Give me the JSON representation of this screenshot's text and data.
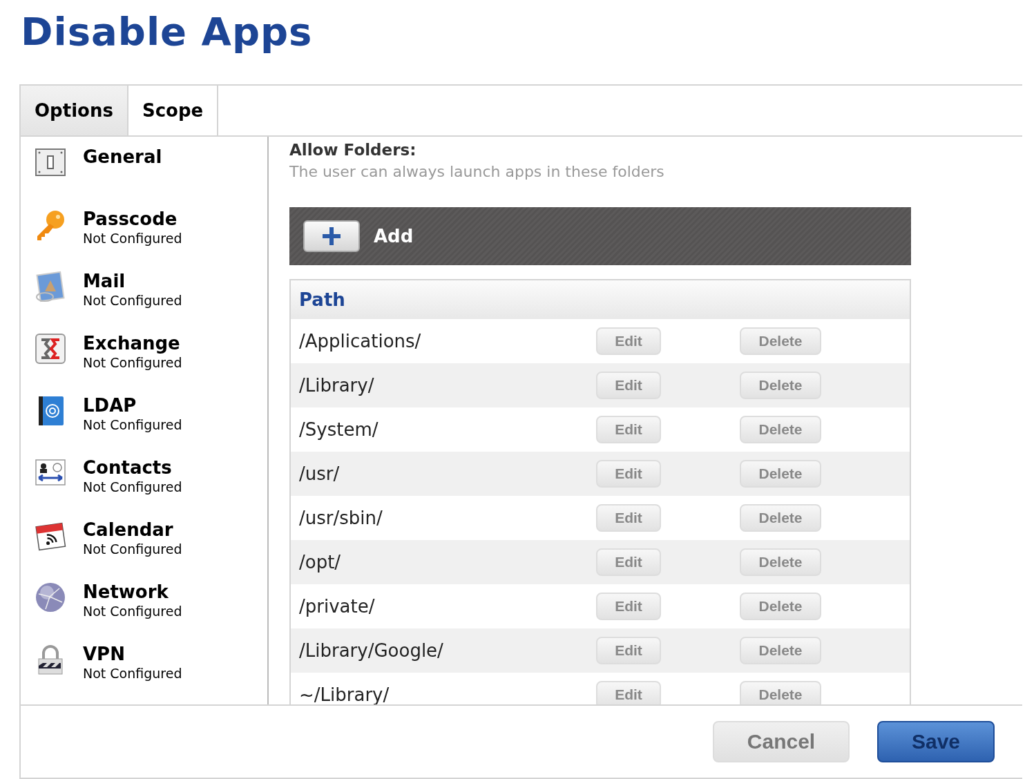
{
  "page": {
    "title": "Disable Apps"
  },
  "tabs": [
    {
      "label": "Options",
      "selected": true
    },
    {
      "label": "Scope",
      "selected": false
    }
  ],
  "sidebar": {
    "items": [
      {
        "name": "General"
      },
      {
        "name": "Passcode",
        "status": "Not Configured"
      },
      {
        "name": "Mail",
        "status": "Not Configured"
      },
      {
        "name": "Exchange",
        "status": "Not Configured"
      },
      {
        "name": "LDAP",
        "status": "Not Configured"
      },
      {
        "name": "Contacts",
        "status": "Not Configured"
      },
      {
        "name": "Calendar",
        "status": "Not Configured"
      },
      {
        "name": "Network",
        "status": "Not Configured"
      },
      {
        "name": "VPN",
        "status": "Not Configured"
      }
    ]
  },
  "section": {
    "title": "Allow Folders:",
    "description": "The user can always launch apps in these folders",
    "add_button": {
      "label": "Add"
    }
  },
  "table": {
    "columns": [
      "Path"
    ],
    "rows": [
      {
        "path": "/Applications/",
        "edit": "Edit",
        "delete": "Delete"
      },
      {
        "path": "/Library/",
        "edit": "Edit",
        "delete": "Delete"
      },
      {
        "path": "/System/",
        "edit": "Edit",
        "delete": "Delete"
      },
      {
        "path": "/usr/",
        "edit": "Edit",
        "delete": "Delete"
      },
      {
        "path": "/usr/sbin/",
        "edit": "Edit",
        "delete": "Delete"
      },
      {
        "path": "/opt/",
        "edit": "Edit",
        "delete": "Delete"
      },
      {
        "path": "/private/",
        "edit": "Edit",
        "delete": "Delete"
      },
      {
        "path": "/Library/Google/",
        "edit": "Edit",
        "delete": "Delete"
      },
      {
        "path": "~/Library/",
        "edit": "Edit",
        "delete": "Delete"
      }
    ]
  },
  "footer": {
    "buttons": [
      {
        "label": "Cancel",
        "kind": "secondary"
      },
      {
        "label": "Save",
        "kind": "primary"
      }
    ]
  }
}
